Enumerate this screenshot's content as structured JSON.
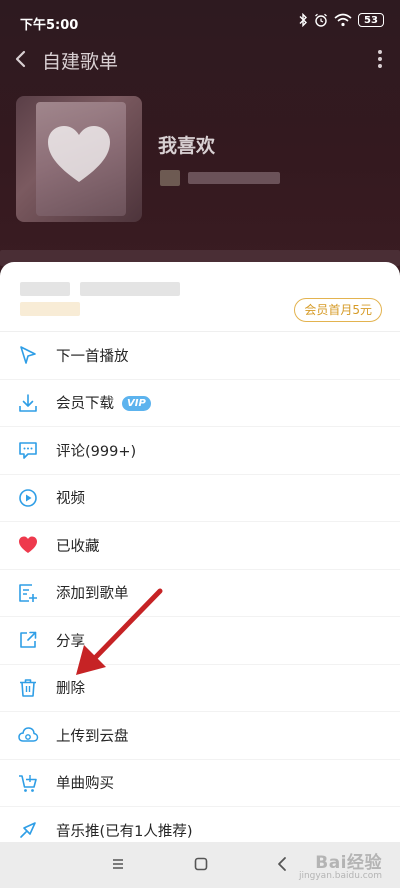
{
  "status_bar": {
    "time": "下午5:00",
    "battery": "53"
  },
  "nav": {
    "title": "自建歌单"
  },
  "playlist": {
    "name": "我喜欢"
  },
  "sheet": {
    "vip_badge": "会员首月5元",
    "items": [
      {
        "label": "下一首播放",
        "icon": "next-play-icon"
      },
      {
        "label": "会员下载",
        "icon": "download-icon",
        "tag": "VIP"
      },
      {
        "label": "评论(999+)",
        "icon": "comment-icon"
      },
      {
        "label": "视频",
        "icon": "video-icon"
      },
      {
        "label": "已收藏",
        "icon": "heart-icon"
      },
      {
        "label": "添加到歌单",
        "icon": "add-to-playlist-icon"
      },
      {
        "label": "分享",
        "icon": "share-icon"
      },
      {
        "label": "删除",
        "icon": "trash-icon"
      },
      {
        "label": "上传到云盘",
        "icon": "cloud-upload-icon"
      },
      {
        "label": "单曲购买",
        "icon": "purchase-icon"
      },
      {
        "label": "音乐推(已有1人推荐)",
        "icon": "recommend-icon"
      }
    ]
  },
  "colors": {
    "accent": "#2f9ee6",
    "heart": "#ee3a4d",
    "vip_gold": "#d69b27"
  },
  "watermark": {
    "main": "Bai经验",
    "sub": "jingyan.baidu.com"
  }
}
